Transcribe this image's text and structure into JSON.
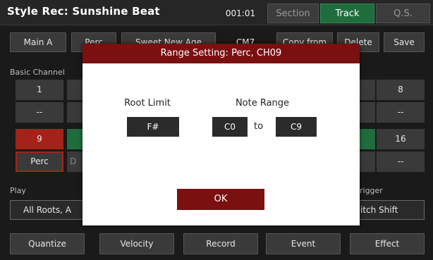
{
  "header": {
    "title": "Style Rec: Sunshine Beat",
    "time": "001:01",
    "tabs": [
      {
        "label": "Section",
        "active": false
      },
      {
        "label": "Track",
        "active": true
      },
      {
        "label": "Q.S.",
        "active": false
      }
    ]
  },
  "top_buttons": {
    "main_a": "Main A",
    "perc": "Perc",
    "sweet_new_age": "Sweet New Age",
    "chord": "CM7",
    "copy_from": "Copy from",
    "delete": "Delete",
    "save": "Save"
  },
  "basic_channel": {
    "label": "Basic Channel",
    "row1": [
      {
        "num": "1",
        "val": "--"
      },
      {
        "num": "8",
        "val": "--"
      }
    ],
    "row2": [
      {
        "num": "9",
        "val": "Perc"
      },
      {
        "num": "16",
        "val": "--"
      }
    ],
    "row2_peek": "D"
  },
  "play": {
    "label": "Play",
    "value": "All Roots, A"
  },
  "trigger": {
    "label": "rigger",
    "value": "itch Shift"
  },
  "bottom_buttons": {
    "quantize": "Quantize",
    "velocity": "Velocity",
    "record": "Record",
    "event": "Event",
    "effect": "Effect"
  },
  "dialog": {
    "title": "Range Setting: Perc, CH09",
    "root_limit_label": "Root Limit",
    "root_limit_value": "F#",
    "note_range_label": "Note Range",
    "note_range_low": "C0",
    "to_label": "to",
    "note_range_high": "C9",
    "ok_label": "OK"
  },
  "colors": {
    "accent_red": "#7a1010",
    "track_green": "#1f6d3c",
    "channel_red": "#a3231b"
  }
}
